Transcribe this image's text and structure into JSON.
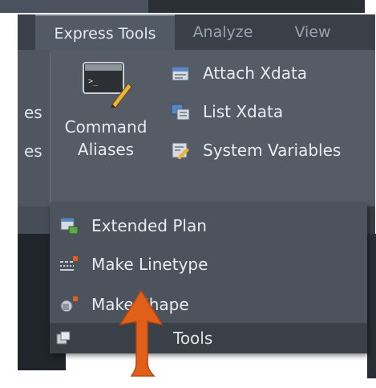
{
  "tabs": [
    {
      "label": "Express Tools",
      "active": true
    },
    {
      "label": "Analyze",
      "active": false
    },
    {
      "label": "View",
      "active": false
    }
  ],
  "left_panel": {
    "text_line_1": "es",
    "text_line_2": "es"
  },
  "ribbon": {
    "command_aliases": {
      "line1": "Command",
      "line2": "Aliases",
      "icon": "command-aliases-icon"
    },
    "items": [
      {
        "label": "Attach Xdata",
        "icon": "attach-xdata-icon"
      },
      {
        "label": "List Xdata",
        "icon": "list-xdata-icon"
      },
      {
        "label": "System Variables",
        "icon": "system-variables-icon"
      }
    ]
  },
  "dropdown": {
    "items": [
      {
        "label": "Extended Plan",
        "icon": "extended-plan-icon"
      },
      {
        "label": "Make Linetype",
        "icon": "make-linetype-icon"
      },
      {
        "label": "Make Shape",
        "icon": "make-shape-icon"
      }
    ],
    "footer_label": "Tools"
  },
  "colors": {
    "ribbon_bg": "#555c66",
    "dropdown_bg": "#4c535d",
    "arrow": "#e0601a",
    "text": "#e8ebef"
  }
}
